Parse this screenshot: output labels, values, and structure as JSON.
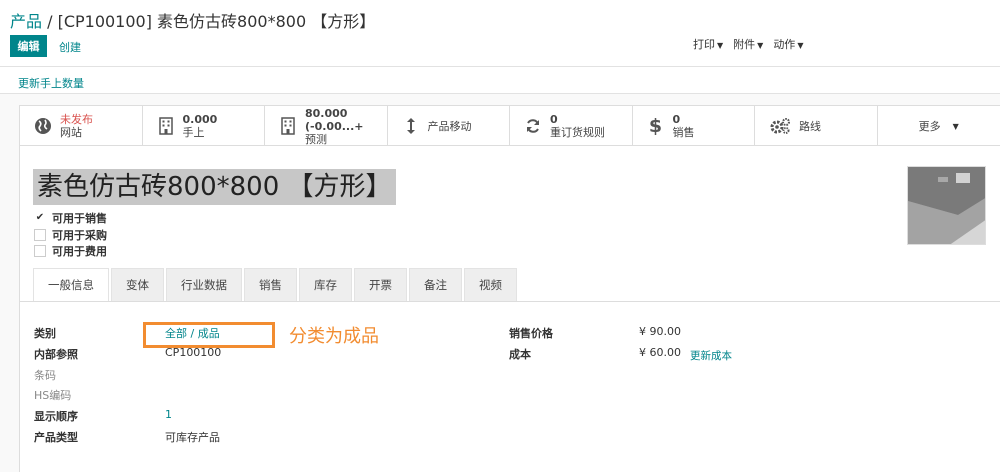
{
  "breadcrumb": {
    "parent": "产品",
    "separator": " / ",
    "current": "[CP100100] 素色仿古砖800*800 【方形】"
  },
  "toolbar": {
    "edit_label": "编辑",
    "create_label": "创建",
    "print_label": "打印",
    "attachment_label": "附件",
    "action_label": "动作"
  },
  "header_button": {
    "update_qty_label": "更新手上数量"
  },
  "smart_buttons": {
    "website": {
      "value": "未发布",
      "label": "网站",
      "icon": "globe-icon"
    },
    "on_hand": {
      "value": "0.000",
      "label": "手上",
      "icon": "building-icon"
    },
    "forecast": {
      "value": "80.000 (-0.00...+",
      "label": "预测",
      "icon": "building-icon"
    },
    "moves": {
      "label": "产品移动",
      "icon": "arrows-v-icon"
    },
    "reorder": {
      "value": "0",
      "label": "重订货规则",
      "icon": "refresh-icon"
    },
    "sales": {
      "value": "0",
      "label": "销售",
      "icon": "dollar-icon"
    },
    "routes": {
      "label": "路线",
      "icon": "cogs-icon"
    },
    "more": {
      "label": "更多"
    }
  },
  "product": {
    "name": "素色仿古砖800*800 【方形】",
    "checkboxes": [
      {
        "label": "可用于销售",
        "checked": true
      },
      {
        "label": "可用于采购",
        "checked": false
      },
      {
        "label": "可用于费用",
        "checked": false
      }
    ]
  },
  "tabs": [
    "一般信息",
    "变体",
    "行业数据",
    "销售",
    "库存",
    "开票",
    "备注",
    "视频"
  ],
  "general_info": {
    "category_label": "类别",
    "category_value": "全部 / 成品",
    "internal_ref_label": "内部参照",
    "internal_ref_value": "CP100100",
    "barcode_label": "条码",
    "hs_code_label": "HS编码",
    "sequence_label": "显示顺序",
    "sequence_value": "1",
    "type_label": "产品类型",
    "type_value": "可库存产品",
    "sale_price_label": "销售价格",
    "sale_price_value": "¥ 90.00",
    "cost_label": "成本",
    "cost_value": "¥ 60.00",
    "update_cost_label": "更新成本"
  },
  "annotation": {
    "text": "分类为成品",
    "color": "#f28c30"
  },
  "colors": {
    "accent": "#00858b",
    "danger": "#d9534f"
  }
}
